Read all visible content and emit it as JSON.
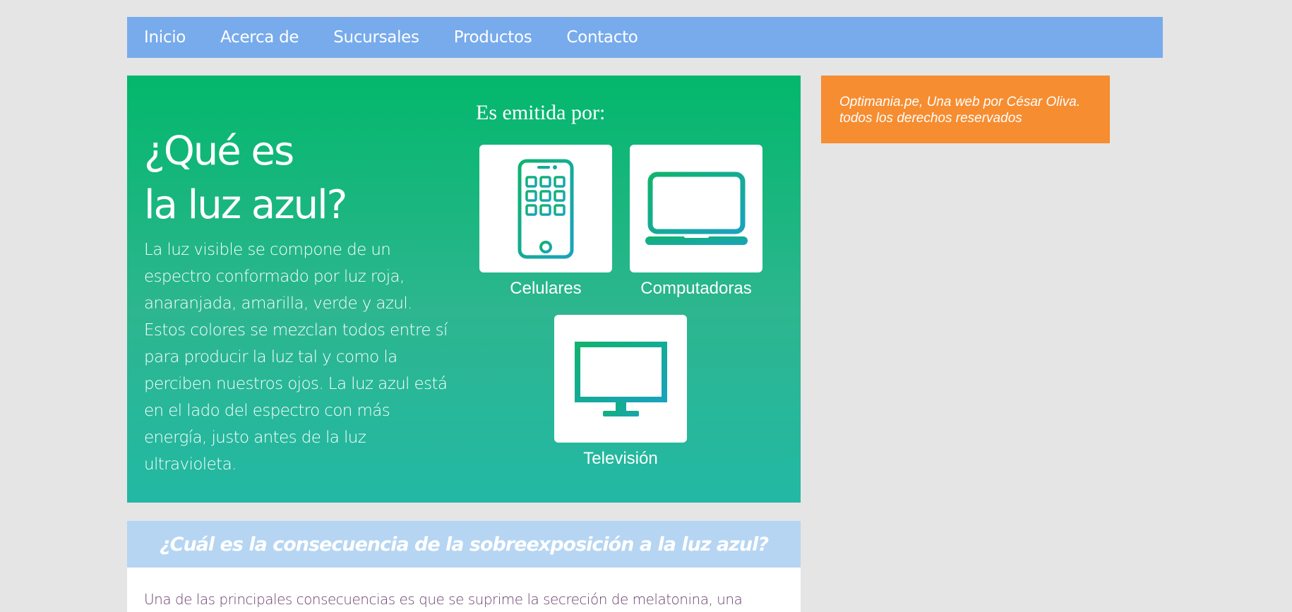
{
  "nav": {
    "items": [
      {
        "label": "Inicio"
      },
      {
        "label": "Acerca de"
      },
      {
        "label": "Sucursales"
      },
      {
        "label": "Productos"
      },
      {
        "label": "Contacto"
      }
    ]
  },
  "hero": {
    "title_line1": "¿Qué es",
    "title_line2": "la luz azul?",
    "text": "La luz visible se compone de un espectro conformado por luz roja, anaranjada, amarilla, verde y azul. Estos colores se mezclan todos entre sí para producir la luz tal y como la perciben nuestros ojos. La luz azul está en el lado del espectro con más energía, justo antes de la luz ultravioleta.",
    "emitted_heading": "Es emitida por:",
    "devices": [
      {
        "label": "Celulares",
        "icon": "smartphone-icon"
      },
      {
        "label": "Computadoras",
        "icon": "laptop-icon"
      },
      {
        "label": "Televisión",
        "icon": "tv-icon"
      }
    ]
  },
  "aside": {
    "line1": "Optimania.pe, Una web por César Oliva.",
    "line2": "todos los derechos reservados"
  },
  "question": {
    "heading": "¿Cuál es la consecuencia de la sobreexposición a la luz azul?",
    "text": "Una de las principales consecuencias es que se suprime la secreción de melatonina, una"
  },
  "colors": {
    "background": "#e5e5e5",
    "nav": "#77abec",
    "hero_top": "#03b76c",
    "hero_bottom": "#22b8a4",
    "aside": "#f68d31",
    "question_bar": "#b5d5f2",
    "answer_text": "#6a3f6e"
  }
}
